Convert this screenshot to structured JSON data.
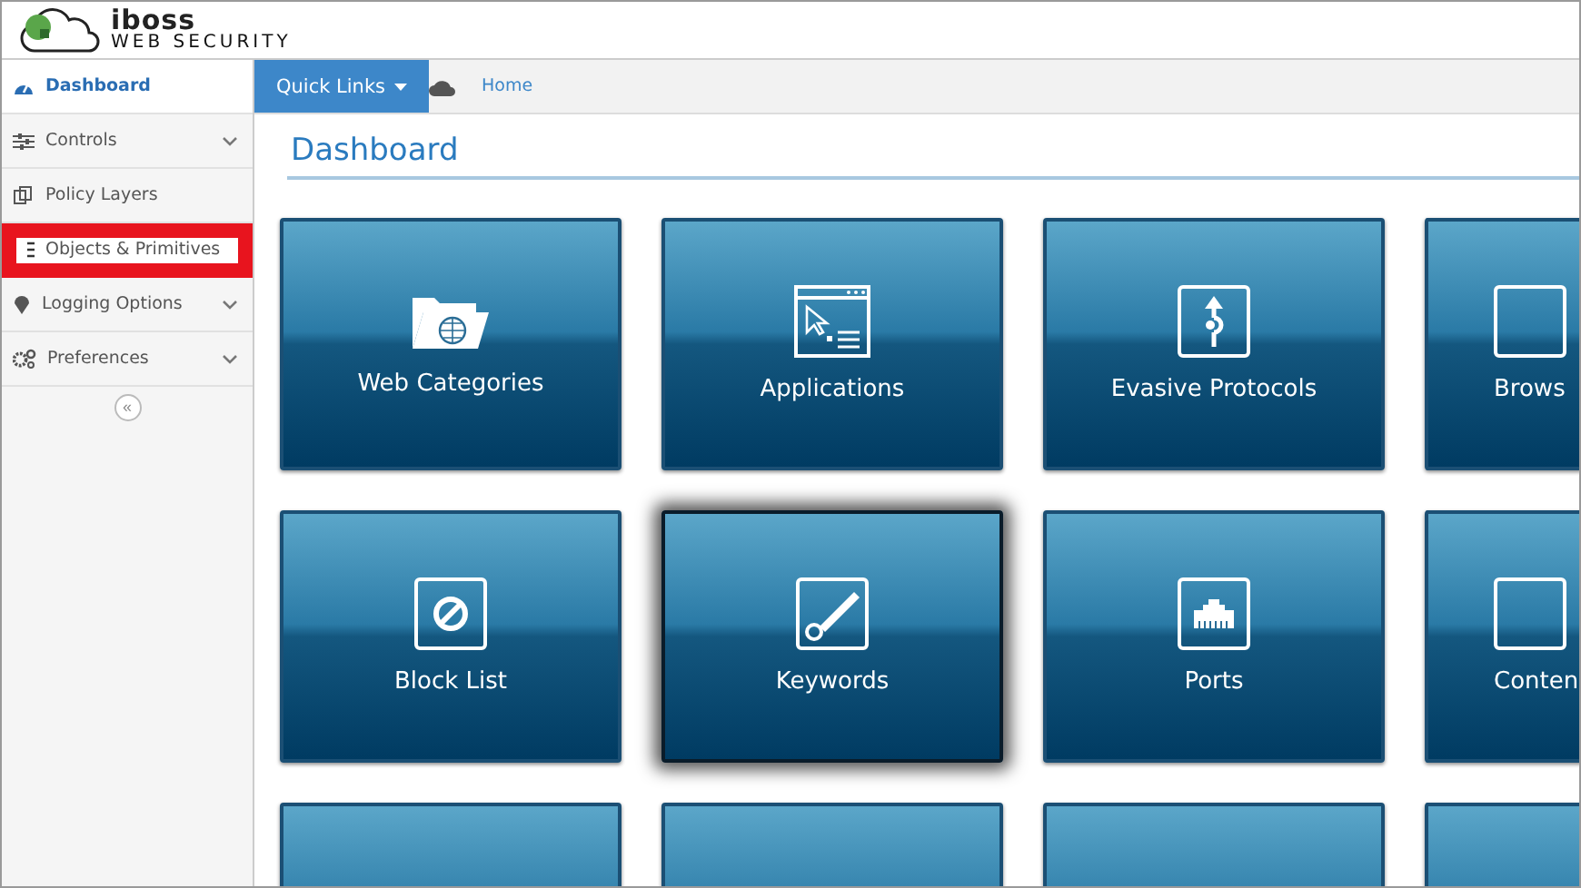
{
  "logo": {
    "brand": "iboss",
    "tagline": "WEB SECURITY"
  },
  "sidebar": {
    "items": [
      {
        "label": "Dashboard",
        "selected": true,
        "has_submenu": false,
        "highlighted": false
      },
      {
        "label": "Controls",
        "selected": false,
        "has_submenu": true,
        "highlighted": false
      },
      {
        "label": "Policy Layers",
        "selected": false,
        "has_submenu": false,
        "highlighted": false
      },
      {
        "label": "Objects & Primitives",
        "selected": false,
        "has_submenu": false,
        "highlighted": true
      },
      {
        "label": "Logging Options",
        "selected": false,
        "has_submenu": true,
        "highlighted": false
      },
      {
        "label": "Preferences",
        "selected": false,
        "has_submenu": true,
        "highlighted": false
      }
    ],
    "collapse": "«"
  },
  "breadcrumb": {
    "quick_links": "Quick Links",
    "home": "Home"
  },
  "page_title": "Dashboard",
  "tiles": [
    {
      "label": "Web Categories",
      "selected": false
    },
    {
      "label": "Applications",
      "selected": false
    },
    {
      "label": "Evasive Protocols",
      "selected": false
    },
    {
      "label": "Brows",
      "selected": false
    },
    {
      "label": "Block List",
      "selected": false
    },
    {
      "label": "Keywords",
      "selected": true
    },
    {
      "label": "Ports",
      "selected": false
    },
    {
      "label": "Conten",
      "selected": false
    },
    {
      "selected": false
    },
    {
      "selected": false
    },
    {
      "selected": false
    },
    {
      "selected": false
    }
  ]
}
